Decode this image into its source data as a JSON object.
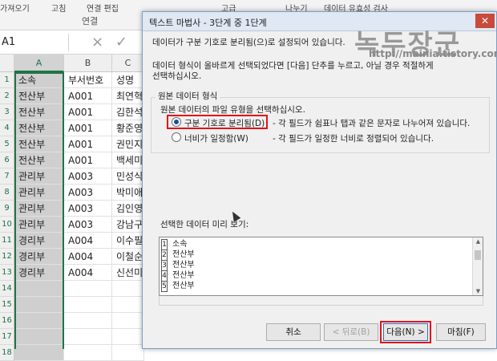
{
  "ribbon": {
    "items": [
      "가져오기",
      "고침",
      "연결 편집",
      "고급",
      "나누기",
      "데이터 유효성 검사"
    ],
    "group": "연결"
  },
  "formula_bar": {
    "name_box": "A1",
    "cancel_icon": "×",
    "enter_icon": "✓"
  },
  "sheet": {
    "columns": [
      "A",
      "B",
      "C"
    ],
    "row_numbers": [
      "1",
      "2",
      "3",
      "4",
      "5",
      "6",
      "7",
      "8",
      "9",
      "10",
      "11",
      "12",
      "13",
      "14",
      "15",
      "16",
      "17",
      "18"
    ],
    "rows": [
      [
        "소속",
        "부서번호",
        "성명"
      ],
      [
        "전산부",
        "A001",
        "최연혁"
      ],
      [
        "전산부",
        "A001",
        "김한석"
      ],
      [
        "전산부",
        "A001",
        "황준영"
      ],
      [
        "전산부",
        "A001",
        "권민지"
      ],
      [
        "전산부",
        "A001",
        "백세미"
      ],
      [
        "관리부",
        "A003",
        "민성식"
      ],
      [
        "관리부",
        "A003",
        "박미애"
      ],
      [
        "관리부",
        "A003",
        "김인영"
      ],
      [
        "관리부",
        "A003",
        "강남구"
      ],
      [
        "경리부",
        "A004",
        "이수필"
      ],
      [
        "경리부",
        "A004",
        "이철순"
      ],
      [
        "경리부",
        "A004",
        "신선미"
      ]
    ]
  },
  "dialog": {
    "title": "텍스트 마법사 - 3단계 중 1단계",
    "close": "✕",
    "line1": "데이터가 구분 기호로 분리됨(으)로 설정되어 있습니다.",
    "line2": "데이터 형식이 올바르게 선택되었다면 [다음] 단추를 누르고, 아닐 경우 적절하게",
    "line3": "선택하십시오.",
    "section_title": "원본 데이터 형식",
    "section_prompt": "원본 데이터의 파일 유형을 선택하십시오.",
    "opt1_label": "구분 기호로 분리됨(D)",
    "opt1_desc": "- 각 필드가 쉼표나 탭과 같은 문자로 나누어져 있습니다.",
    "opt2_label": "너비가 일정함(W)",
    "opt2_desc": "- 각 필드가 일정한 너비로 정렬되어 있습니다.",
    "preview_label": "선택한 데이터 미리 보기:",
    "preview_rows": [
      {
        "num": "1",
        "text": "소속"
      },
      {
        "num": "2",
        "text": "전산부"
      },
      {
        "num": "3",
        "text": "전산부"
      },
      {
        "num": "4",
        "text": "전산부"
      },
      {
        "num": "5",
        "text": "전산부"
      }
    ],
    "buttons": {
      "cancel": "취소",
      "back": "< 뒤로(B)",
      "next": "다음(N) >",
      "finish": "마침(F)"
    }
  },
  "watermark": {
    "logo": "녹두장군",
    "url": "http://mainia.tistory.com"
  },
  "colors": {
    "excel_green": "#217346",
    "highlight_red": "#e0141a",
    "dialog_border": "#7a9fc7"
  }
}
